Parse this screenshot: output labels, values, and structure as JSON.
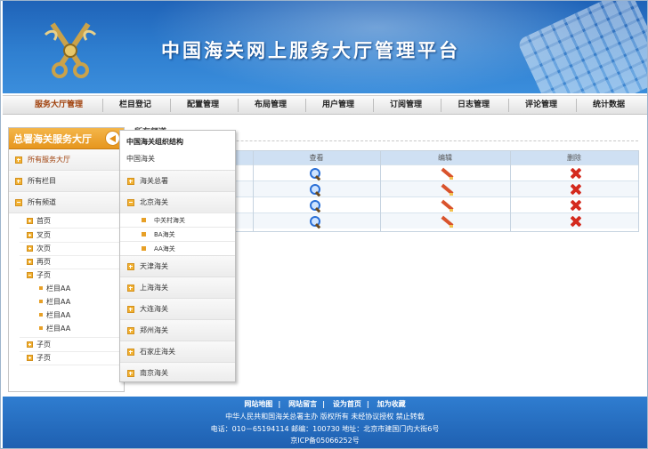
{
  "banner": {
    "title": "中国海关网上服务大厅管理平台"
  },
  "nav": {
    "items": [
      "服务大厅管理",
      "栏目登记",
      "配置管理",
      "布局管理",
      "用户管理",
      "订阅管理",
      "日志管理",
      "评论管理",
      "统计数据"
    ],
    "active": "服务大厅管理"
  },
  "sidebar": {
    "header": "总署海关服务大厅",
    "sections": [
      "所有服务大厅",
      "所有栏目",
      "所有频道"
    ],
    "channel_items": [
      "首页",
      "叉页",
      "次页",
      "再页",
      "子页"
    ],
    "column_items": [
      "栏目AA",
      "栏目AA",
      "栏目AA",
      "栏目AA"
    ],
    "tail_items": [
      "子页",
      "子页"
    ]
  },
  "content": {
    "title": "所有频道",
    "table": {
      "headers": [
        "",
        "查看",
        "编辑",
        "删除"
      ],
      "row_count": 4
    }
  },
  "popup": {
    "title": "中国海关组织结构",
    "root": "中国海关",
    "nodes": [
      "海关总署",
      "北京海关"
    ],
    "children": [
      "中关村海关",
      "BA海关",
      "AA海关"
    ],
    "others": [
      "天津海关",
      "上海海关",
      "大连海关",
      "郑州海关",
      "石家庄海关",
      "南京海关"
    ]
  },
  "footer": {
    "links": [
      "网站地图",
      "网站留言",
      "设为首页",
      "加为收藏"
    ],
    "separator": "|",
    "line1": "中华人民共和国海关总署主办  版权所有  未经协议授权  禁止转载",
    "line2": "电话：010－65194114  邮编：100730    地址：北京市建国门内大街6号",
    "line3": "京ICP备05066252号"
  },
  "colors": {
    "banner": "#2f7fd0",
    "accent": "#e6961e",
    "active_nav": "#a0410c"
  }
}
